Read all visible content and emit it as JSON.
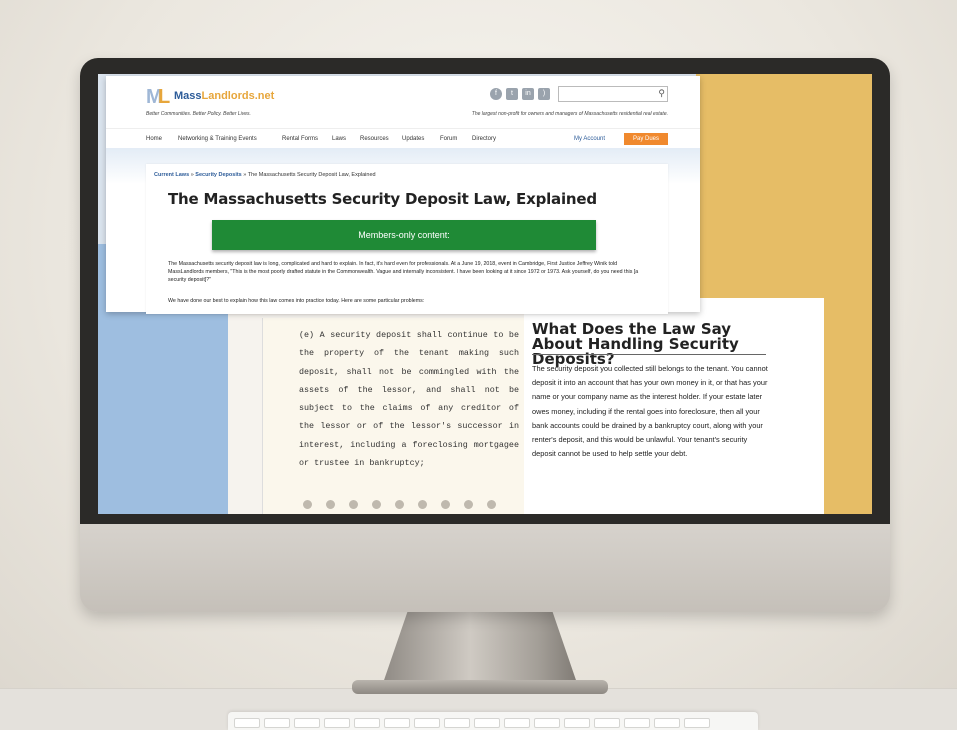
{
  "site": {
    "logo_part1": "Mass",
    "logo_part2": "Landlords.net",
    "tagline": "Better Communities. Better Policy. Better Lives.",
    "slogan": "The largest non-profit for owners and managers of Massachusetts residential real estate.",
    "search_placeholder": "",
    "social_icons": [
      "facebook-icon",
      "twitter-icon",
      "linkedin-icon",
      "rss-icon"
    ],
    "nav": {
      "home": "Home",
      "networking": "Networking & Training Events",
      "rental_forms": "Rental Forms",
      "laws": "Laws",
      "resources": "Resources",
      "updates": "Updates",
      "forum": "Forum",
      "directory": "Directory",
      "my_account": "My Account",
      "pay_dues": "Pay Dues"
    },
    "accent_colors": {
      "blue": "#2d5c99",
      "orange": "#f0892e",
      "green": "#1f8a36"
    }
  },
  "article": {
    "breadcrumb": {
      "current_laws": "Current Laws",
      "separator1": "»",
      "security_deposits": "Security Deposits",
      "separator2": "»",
      "current": "The Massachusetts Security Deposit Law, Explained"
    },
    "title": "The Massachusetts Security Deposit Law, Explained",
    "members_only": "Members-only content:",
    "intro": "The Massachusetts security deposit law is long, complicated and hard to explain. In fact, it's hard even for professionals. At a June 19, 2018, event in Cambridge, First Justice Jeffrey Winik told MassLandlords members, \"This is the most poorly drafted statute in the Commonwealth. Vague and internally inconsistent. I have been looking at it since 1972 or 1973. Ask yourself, do you need this [a security deposit]?\"",
    "intro2": "We have done our best to explain how this law comes into practice today. Here are some particular problems:"
  },
  "statute": {
    "text": "(e) A security deposit shall continue to be the property of the tenant making such deposit, shall not be commingled with the assets of the lessor, and shall not be subject to the claims of any creditor of the lessor or of the lessor's successor in interest, including a foreclosing mortgagee or trustee in bankruptcy;"
  },
  "explain": {
    "title": "What Does the Law Say About Handling Security Deposits?",
    "body": "The security deposit you collected still belongs to the tenant. You cannot deposit it into an account that has your own money in it, or that has your name or your company name as the interest holder. If your estate later owes money, including if the rental goes into foreclosure, then all your bank accounts could be drained by a bankruptcy court, along with your renter's deposit, and this would be unlawful. Your tenant's security deposit cannot be used to help settle your debt."
  }
}
